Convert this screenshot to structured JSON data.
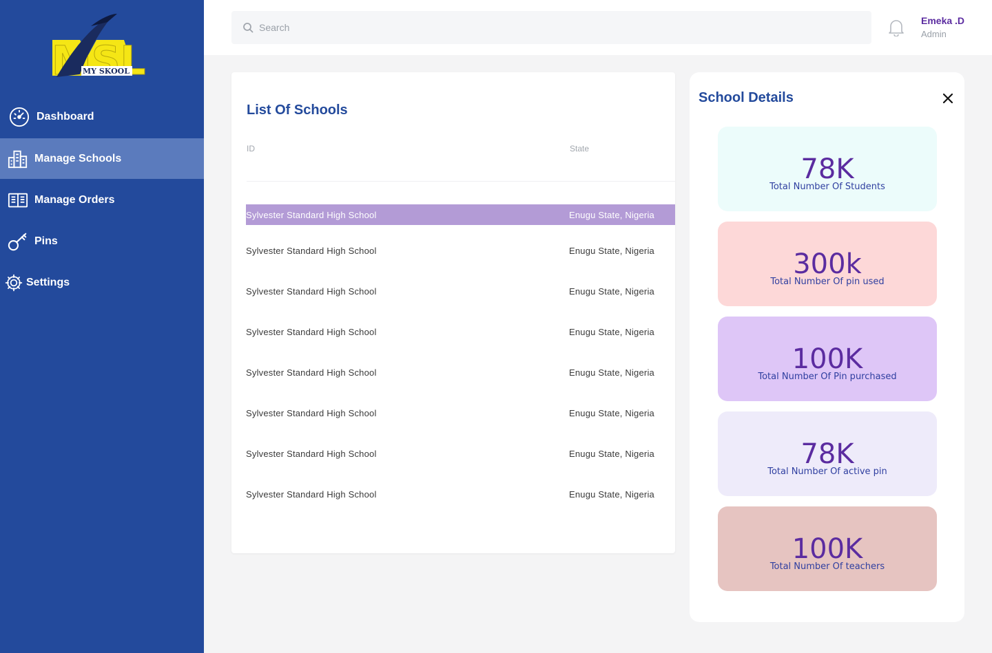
{
  "brand": {
    "logo_text": "MSL",
    "logo_subtext": "MY SKOOL"
  },
  "sidebar": {
    "items": [
      {
        "label": "Dashboard",
        "icon": "speedometer-icon"
      },
      {
        "label": "Manage Schools",
        "icon": "buildings-icon",
        "active": true
      },
      {
        "label": "Manage Orders",
        "icon": "book-icon"
      },
      {
        "label": "Pins",
        "icon": "key-icon"
      },
      {
        "label": "Settings",
        "icon": "gear-icon"
      }
    ]
  },
  "header": {
    "search_placeholder": "Search",
    "user": {
      "name": "Emeka .D",
      "role": "Admin"
    }
  },
  "schools": {
    "title": "List Of Schools",
    "columns": [
      "ID",
      "State"
    ],
    "rows": [
      {
        "name": "Sylvester Standard High School",
        "state": "Enugu State, Nigeria"
      },
      {
        "name": "Sylvester Standard High School",
        "state": "Enugu State, Nigeria"
      },
      {
        "name": "Sylvester Standard High School",
        "state": "Enugu State, Nigeria"
      },
      {
        "name": "Sylvester Standard High School",
        "state": "Enugu State, Nigeria"
      },
      {
        "name": "Sylvester Standard High School",
        "state": "Enugu State, Nigeria"
      },
      {
        "name": "Sylvester Standard High School",
        "state": "Enugu State, Nigeria"
      },
      {
        "name": "Sylvester Standard High School",
        "state": "Enugu State, Nigeria"
      },
      {
        "name": "Sylvester Standard High School",
        "state": "Enugu State, Nigeria"
      }
    ]
  },
  "details": {
    "title": "School Details",
    "stats": [
      {
        "value": "78K",
        "label": "Total Number Of Students",
        "color": "#ecfcfb"
      },
      {
        "value": "300k",
        "label": "Total Number Of pin used",
        "color": "#fdd8d8"
      },
      {
        "value": "100K",
        "label": "Total Number Of Pin purchased",
        "color": "#dec6f7"
      },
      {
        "value": "78K",
        "label": "Total Number Of active pin",
        "color": "#eeebfa"
      },
      {
        "value": "100K",
        "label": "Total Number Of teachers",
        "color": "#e6c4c1"
      }
    ]
  },
  "colors": {
    "sidebar": "#234a9c",
    "sidebar_active": "#5b7bbd",
    "accent_purple": "#5b2ca0",
    "selected_row": "#b39bd6"
  }
}
